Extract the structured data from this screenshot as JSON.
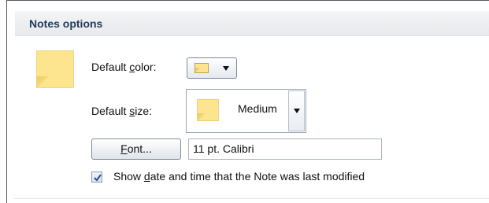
{
  "section": {
    "title": "Notes options"
  },
  "default_color": {
    "label_prefix": "Default ",
    "label_accel": "c",
    "label_suffix": "olor:",
    "swatch_color": "#fde48f"
  },
  "default_size": {
    "label_prefix": "Default ",
    "label_accel": "s",
    "label_suffix": "ize:",
    "value": "Medium"
  },
  "font": {
    "button_accel": "F",
    "button_suffix": "ont...",
    "value": "11 pt. Calibri"
  },
  "show_date_time": {
    "checked": true,
    "label_prefix": "Show ",
    "label_accel": "d",
    "label_suffix": "ate and time that the Note was last modified"
  },
  "icons": {
    "note": "note-icon",
    "dropdown": "chevron-down-icon",
    "check": "check-icon"
  },
  "colors": {
    "note_yellow": "#fde48f",
    "header_text": "#1f3c5a",
    "check_blue": "#2b4f86"
  }
}
